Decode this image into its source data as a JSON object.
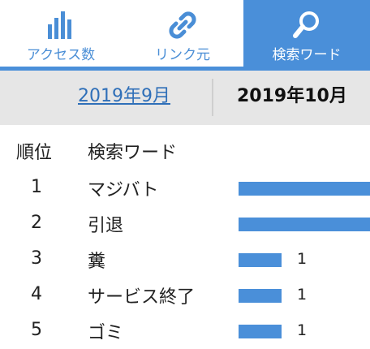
{
  "tabs": [
    {
      "label": "アクセス数",
      "icon": "bar-chart-icon"
    },
    {
      "label": "リンク元",
      "icon": "link-icon"
    },
    {
      "label": "検索ワード",
      "icon": "magnifier-icon"
    }
  ],
  "months": {
    "previous": "2019年9月",
    "current": "2019年10月"
  },
  "table": {
    "headers": {
      "rank": "順位",
      "word": "検索ワード"
    },
    "rows": [
      {
        "rank": "1",
        "word": "マジバト",
        "count": "",
        "bar_fraction": 1.0
      },
      {
        "rank": "2",
        "word": "引退",
        "count": "",
        "bar_fraction": 1.0
      },
      {
        "rank": "3",
        "word": "糞",
        "count": "1",
        "bar_fraction": 0.33
      },
      {
        "rank": "4",
        "word": "サービス終了",
        "count": "1",
        "bar_fraction": 0.33
      },
      {
        "rank": "5",
        "word": "ゴミ",
        "count": "1",
        "bar_fraction": 0.33
      }
    ]
  },
  "colors": {
    "accent": "#4a8fd9",
    "link": "#2f6fb8",
    "monthbar": "#e6e6e6"
  }
}
